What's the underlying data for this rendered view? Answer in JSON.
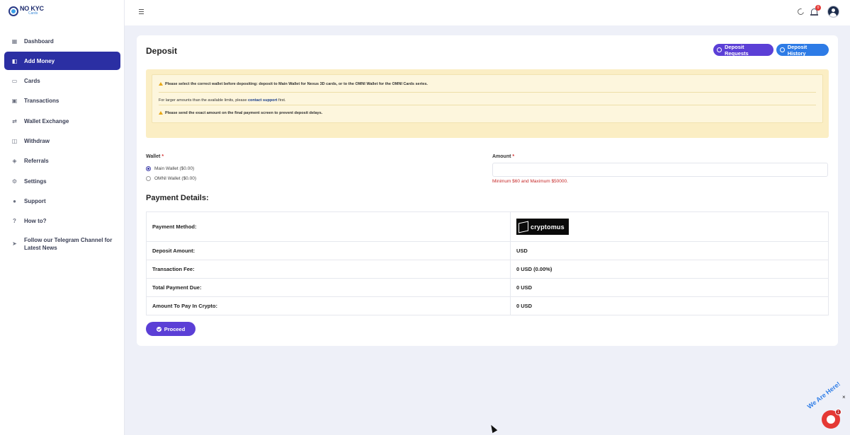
{
  "brand": {
    "title": "NO KYC",
    "subtitle": "Cards"
  },
  "sidebar": {
    "items": [
      {
        "label": "Dashboard",
        "icon": "dashboard-icon"
      },
      {
        "label": "Add Money",
        "icon": "wallet-add-icon"
      },
      {
        "label": "Cards",
        "icon": "card-icon"
      },
      {
        "label": "Transactions",
        "icon": "transactions-icon"
      },
      {
        "label": "Wallet Exchange",
        "icon": "exchange-icon"
      },
      {
        "label": "Withdraw",
        "icon": "withdraw-icon"
      },
      {
        "label": "Referrals",
        "icon": "referrals-icon"
      },
      {
        "label": "Settings",
        "icon": "gear-icon"
      },
      {
        "label": "Support",
        "icon": "info-icon"
      },
      {
        "label": "How to?",
        "icon": "question-icon"
      },
      {
        "label": "Follow our Telegram Channel for Latest News",
        "icon": "telegram-icon"
      }
    ],
    "active_index": 1
  },
  "topbar": {
    "notification_count": "0"
  },
  "page": {
    "title": "Deposit",
    "deposit_requests_label": "Deposit Requests",
    "deposit_history_label": "Deposit History"
  },
  "notice": {
    "line1": "Please select the correct wallet before depositing: deposit to Main Wallet for Nexus 3D cards, or to the OMNI Wallet for the OMNI Cards series.",
    "line2_prefix": "For larger amounts than the available limits, please ",
    "line2_link": "contact support",
    "line2_suffix": " first.",
    "line3": "Please send the exact amount on the final payment screen to prevent deposit delays."
  },
  "form": {
    "wallet_label": "Wallet",
    "amount_label": "Amount",
    "required_mark": "*",
    "wallet_options": [
      "Main Wallet ($0.00)",
      "OMNI Wallet ($0.00)"
    ],
    "selected_wallet": 0,
    "amount_value": "",
    "amount_hint": "Minimum $60 and Maximum $50000."
  },
  "payment": {
    "title": "Payment Details:",
    "method_label": "Payment Method:",
    "method_logo_text": "cryptomus",
    "rows": [
      {
        "label": "Deposit Amount:",
        "value": "USD"
      },
      {
        "label": "Transaction Fee:",
        "value": "0 USD (0.00%)"
      },
      {
        "label": "Total Payment Due:",
        "value": "0 USD"
      },
      {
        "label": "Amount To Pay In Crypto:",
        "value": "0 USD"
      }
    ],
    "proceed_label": "Proceed"
  },
  "chat": {
    "banner": "We Are Here!",
    "close": "×",
    "badge": "1"
  }
}
